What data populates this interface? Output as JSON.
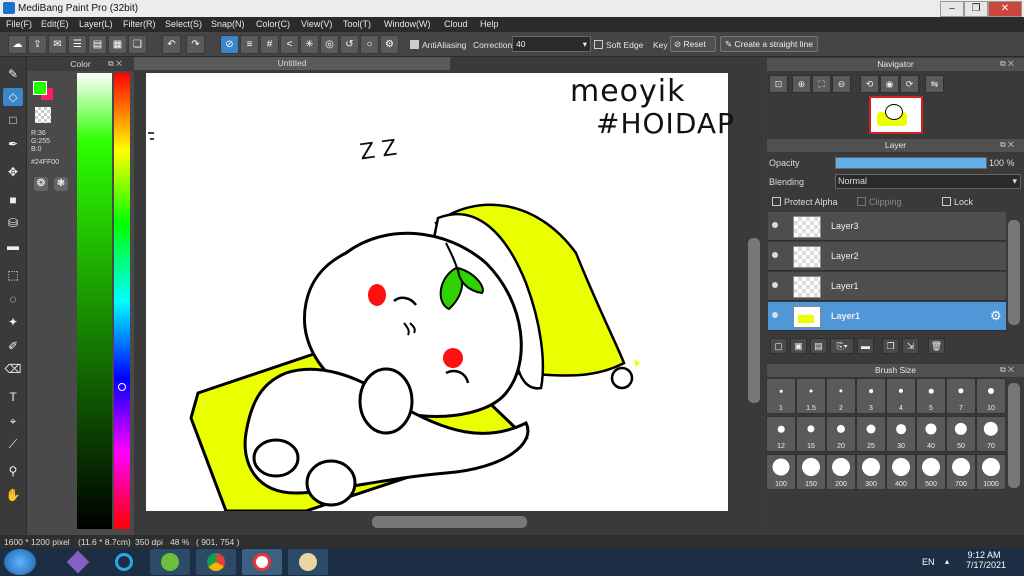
{
  "window": {
    "title": "MediBang Paint Pro (32bit)",
    "minimize": "–",
    "restore": "❐",
    "close": "✕"
  },
  "menu": [
    "File(F)",
    "Edit(E)",
    "Layer(L)",
    "Filter(R)",
    "Select(S)",
    "Snap(N)",
    "Color(C)",
    "View(V)",
    "Tool(T)",
    "Window(W)",
    "Cloud",
    "Help"
  ],
  "toolbar": {
    "antialiasing": "AntiAliasing",
    "correction_label": "Correction",
    "correction_value": "40",
    "soft_edge": "Soft Edge",
    "key": "Key",
    "reset": "Reset",
    "straight_line": "Create a straight line"
  },
  "color_panel": {
    "title": "Color",
    "r": "R:36",
    "g": "G:255",
    "b": "B:0",
    "hex": "#24FF00",
    "fg": "#24ff00",
    "bg": "#ff1b6b"
  },
  "canvas": {
    "tab": "Untitled",
    "handwriting_line1": "meoyik",
    "handwriting_line2": "#HOIDAP",
    "zzz": "Z Z",
    "accent_yellow": "#eaff00",
    "accent_green": "#2fd400",
    "accent_red": "#ff1010"
  },
  "navigator": {
    "title": "Navigator"
  },
  "layer_panel": {
    "title": "Layer",
    "opacity_label": "Opacity",
    "opacity_value": "100 %",
    "opacity": 1.0,
    "blending_label": "Blending",
    "blending_value": "Normal",
    "protect_alpha": "Protect Alpha",
    "clipping": "Clipping",
    "lock": "Lock",
    "layers": [
      {
        "name": "Layer3"
      },
      {
        "name": "Layer2"
      },
      {
        "name": "Layer1"
      },
      {
        "name": "Layer1"
      }
    ]
  },
  "brush_panel": {
    "title": "Brush Size",
    "sizes": [
      "1",
      "1.5",
      "2",
      "3",
      "4",
      "5",
      "7",
      "10",
      "12",
      "15",
      "20",
      "25",
      "30",
      "40",
      "50",
      "70",
      "100",
      "150",
      "200",
      "300",
      "400",
      "500",
      "700",
      "1000"
    ]
  },
  "status": {
    "dimensions": "1600 * 1200 pixel",
    "physical": "(11.6 * 8.7cm)",
    "dpi": "350 dpi",
    "zoom": "48 %",
    "cursor": "( 901, 754 )"
  },
  "taskbar": {
    "lang": "EN",
    "time": "9:12 AM",
    "date": "7/17/2021"
  }
}
